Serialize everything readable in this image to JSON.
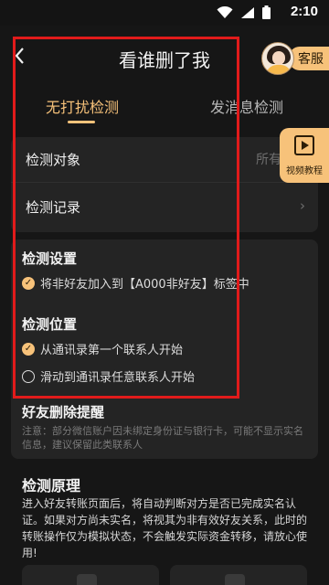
{
  "status_bar": {
    "time": "2:10"
  },
  "header": {
    "back_icon": "back-chevron-icon",
    "title": "看谁删了我"
  },
  "customer_service": {
    "label": "客服",
    "icon": "agent-avatar"
  },
  "tabs": [
    {
      "label": "无打扰检测",
      "active": true
    },
    {
      "label": "发消息检测",
      "active": false
    }
  ],
  "detect_card": {
    "target_label": "检测对象",
    "target_value": "所有好友",
    "records_label": "检测记录"
  },
  "video_tutorial": {
    "label": "视频教程",
    "icon": "video-icon"
  },
  "settings_card": {
    "settings_title": "检测设置",
    "settings_option": "将非好友加入到【A000非好友】标签中",
    "position_title": "检测位置",
    "position_options": [
      {
        "label": "从通讯录第一个联系人开始",
        "checked": true
      },
      {
        "label": "滑动到通讯录任意联系人开始",
        "checked": false
      }
    ],
    "reminder_title": "好友删除提醒",
    "note": "注意：部分微信账户因未绑定身份证与银行卡，可能不显示实名信息，建议保留此类联系人"
  },
  "principle": {
    "title": "检测原理",
    "text": "进入好友转账页面后，将自动判断对方是否已完成实名认证。如果对方尚未实名，将视其为非有效好友关系，此时的转账操作仅为模拟状态，不会触发实际资金转移，请放心使用!"
  },
  "colors": {
    "accent": "#f7c27a",
    "frame": "#e11b1b",
    "background": "#161616",
    "card": "#242424"
  }
}
